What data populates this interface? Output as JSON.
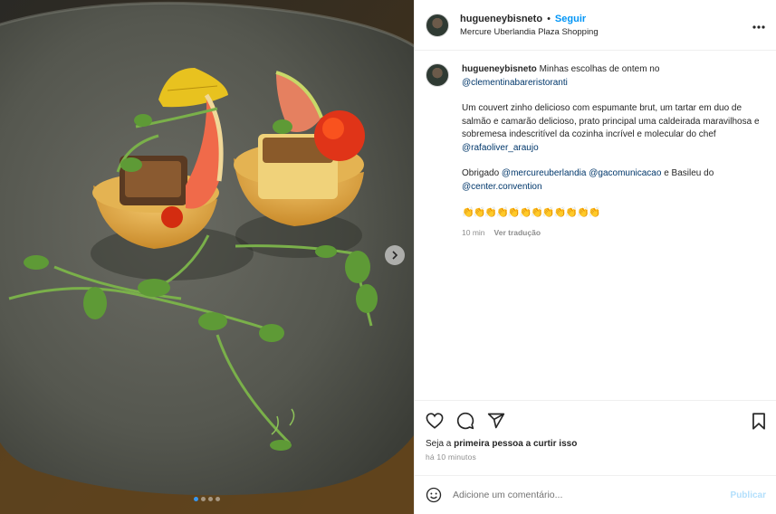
{
  "post": {
    "username": "hugueneybisneto",
    "separator": "•",
    "follow_label": "Seguir",
    "location": "Mercure Uberlandia Plaza Shopping",
    "more_label": "•••",
    "image_alt": "Prato com tartar de salmão e camarão em cestinhas, com brotos de ervilha"
  },
  "caption": {
    "username": "hugueneybisneto",
    "line1_text": "Minhas escolhas de ontem no",
    "mention_restaurant": "@clementinabareristoranti",
    "p2_a": "Um couvert zinho delicioso com espumante brut, um tartar em duo de salmão e camarão delicioso, prato principal uma caldeirada maravilhosa e sobremesa indescritível da cozinha incrível e molecular do chef",
    "mention_chef": "@rafaoliver_araujo",
    "p3_a": "Obrigado",
    "mention_hotel": "@mercureuberlandia",
    "mention_agency": "@gacomunicacao",
    "p3_b": "e Basileu do",
    "mention_center": "@center.convention",
    "emojis": "👏👏👏👏👏👏👏👏👏👏👏👏",
    "time": "10 min",
    "translate": "Ver tradução"
  },
  "actions": {
    "icons": [
      "heart-icon",
      "comment-icon",
      "share-icon",
      "bookmark-icon"
    ],
    "likes_prompt_a": "Seja a ",
    "likes_prompt_b": "primeira pessoa a curtir isso",
    "timestamp": "há 10 minutos"
  },
  "comment_box": {
    "placeholder": "Adicione um comentário...",
    "post_label": "Publicar"
  },
  "carousel": {
    "count": 4,
    "active_index": 0
  },
  "colors": {
    "accent": "#0095f6",
    "mention": "#00376b",
    "muted": "#8e8e8e",
    "post_disabled": "#b2dffc"
  }
}
